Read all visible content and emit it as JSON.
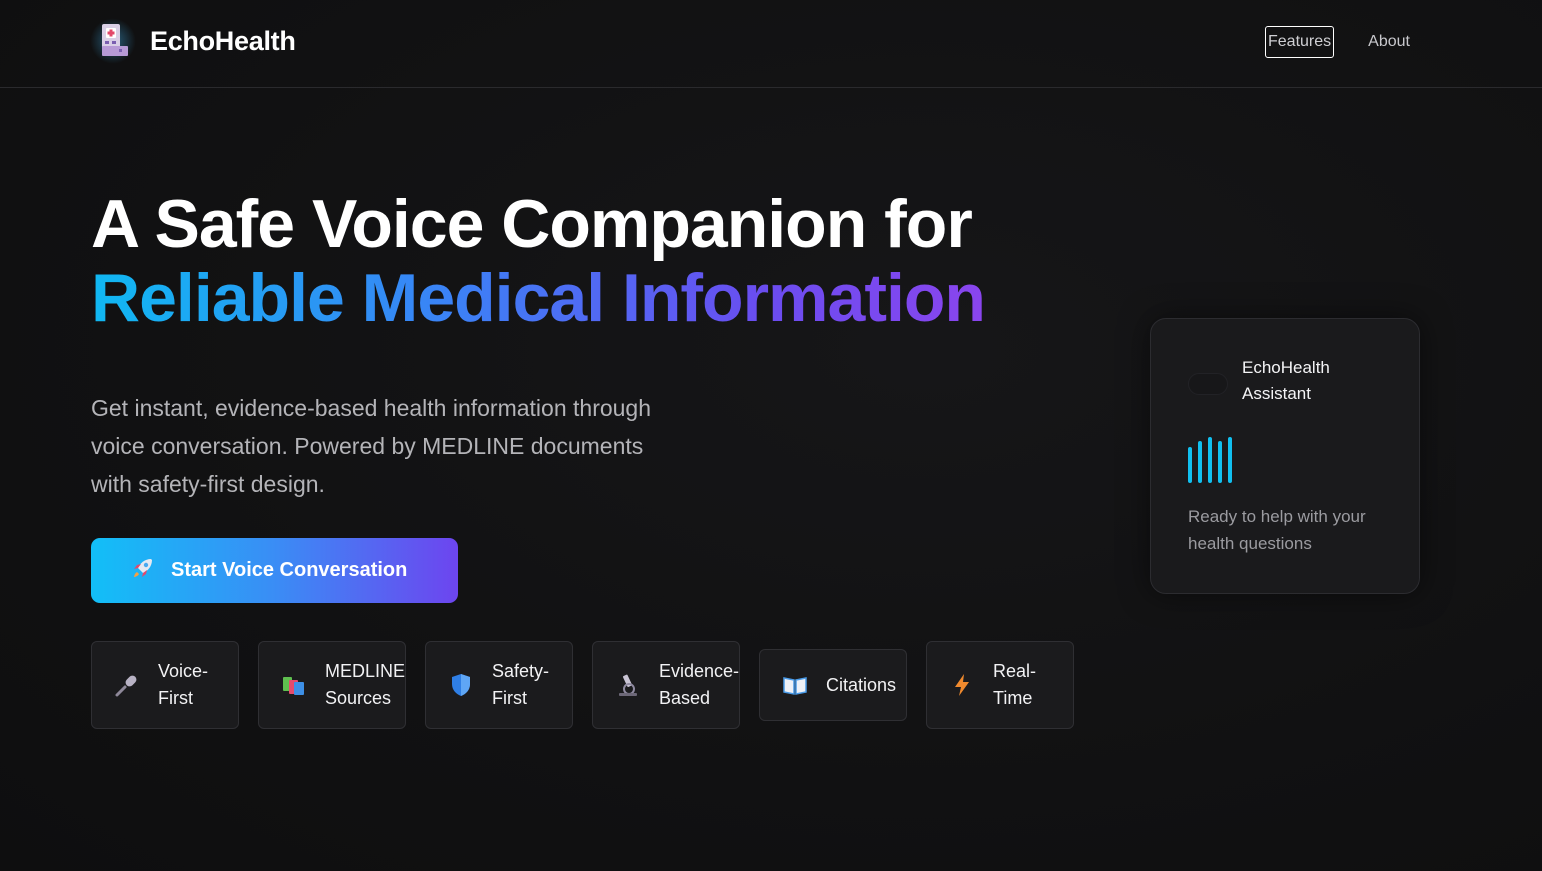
{
  "header": {
    "brand": "EchoHealth",
    "logo_icon": "hospital-icon",
    "nav": [
      {
        "label": "Features"
      },
      {
        "label": "About"
      }
    ]
  },
  "hero": {
    "title_line1": "A Safe Voice Companion for",
    "title_line2": "Reliable Medical Information",
    "description": "Get instant, evidence-based health information through voice conversation. Powered by MEDLINE documents with safety-first design.",
    "cta_label": "Start Voice Conversation",
    "cta_icon": "rocket-icon",
    "gradient_colors": [
      "#10b8f2",
      "#3b82f6",
      "#8a45ee"
    ]
  },
  "features": [
    {
      "label": "Voice-First",
      "icon": "microphone-icon"
    },
    {
      "label": "MEDLINE Sources",
      "icon": "books-icon"
    },
    {
      "label": "Safety-First",
      "icon": "shield-icon"
    },
    {
      "label": "Evidence-Based",
      "icon": "microscope-icon"
    },
    {
      "label": "Citations",
      "icon": "book-icon"
    },
    {
      "label": "Real-Time",
      "icon": "lightning-icon"
    }
  ],
  "assistant_card": {
    "title": "EchoHealth Assistant",
    "status": "",
    "waveform_icon": "waveform-icon",
    "message": "Ready to help with your health questions",
    "accent": "#11c0f0"
  }
}
